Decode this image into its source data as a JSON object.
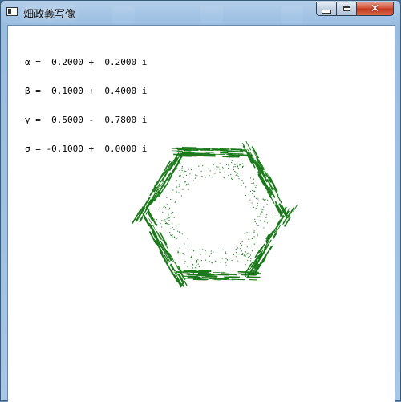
{
  "window": {
    "title": "畑政義写像",
    "buttons": {
      "minimize": "minimize-icon",
      "maximize": "maximize-icon",
      "close_label": "✕"
    }
  },
  "parameters": [
    {
      "symbol": "α",
      "text": " =  0.2000 +  0.2000 i"
    },
    {
      "symbol": "β",
      "text": " =  0.1000 +  0.4000 i"
    },
    {
      "symbol": "γ",
      "text": " =  0.5000 -  0.7800 i"
    },
    {
      "symbol": "σ",
      "text": " = -0.1000 +  0.0000 i"
    }
  ],
  "fractal": {
    "color": "#1a7a1a",
    "map": "hata"
  }
}
